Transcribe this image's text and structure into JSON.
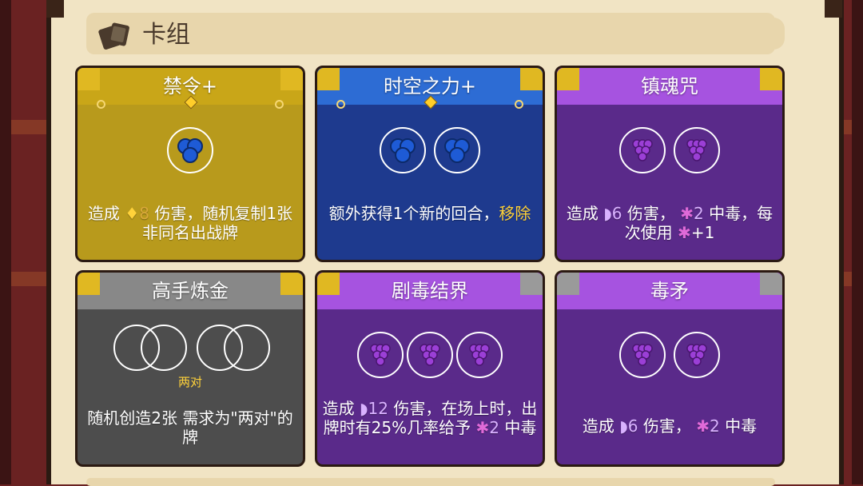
{
  "colors": {
    "gold_card": "#b89a1c",
    "gold_top": "#c9a618",
    "blue_card": "#1e3a8e",
    "blue_top": "#2d6cd4",
    "purple_card": "#5a2a8a",
    "purple_top": "#a653e0",
    "gray_card": "#4d4d4d",
    "gray_top": "#888888",
    "panel_bg": "#f1e4c4"
  },
  "header": {
    "title": "卡组",
    "icon": "cards-icon"
  },
  "cards": [
    {
      "name": "禁令+",
      "rarity_color": "gold",
      "requirements": [
        "blue-orb-icon"
      ],
      "description": {
        "pre": "造成 ",
        "sym": "♦",
        "num": "8",
        "post": " 伤害，随机复制1张非同名出战牌"
      }
    },
    {
      "name": "时空之力+",
      "rarity_color": "blue",
      "requirements": [
        "blue-orb-icon",
        "blue-orb-icon"
      ],
      "description": {
        "pre": "额外获得1个新的回合，",
        "highlight": "移除"
      }
    },
    {
      "name": "镇魂咒",
      "rarity_color": "purple",
      "requirements": [
        "purple-grape-icon",
        "purple-grape-icon"
      ],
      "description": {
        "pre": "造成 ",
        "sym": "◗",
        "num": "6",
        "mid": " 伤害， ",
        "sym2": "✱",
        "num2": "2",
        "post": " 中毒，每次使用 ",
        "sym3": "✱",
        "num3": "+1"
      }
    },
    {
      "name": "高手炼金",
      "rarity_color": "gray",
      "requirements": [
        "empty-pair-icon",
        "empty-pair-icon"
      ],
      "pair_label": "两对",
      "description": {
        "pre": "随机创造2张 需求为\"两对\"的牌"
      }
    },
    {
      "name": "剧毒结界",
      "rarity_color": "purple",
      "requirements": [
        "purple-grape-icon",
        "purple-grape-icon",
        "purple-grape-icon"
      ],
      "description": {
        "pre": "造成 ",
        "sym": "◗",
        "num": "12",
        "mid": " 伤害，在场上时，出牌时有25%几率给予 ",
        "sym2": "✱",
        "num2": "2",
        "post": " 中毒"
      }
    },
    {
      "name": "毒矛",
      "rarity_color": "purple",
      "requirements": [
        "purple-grape-icon",
        "purple-grape-icon"
      ],
      "description": {
        "pre": "造成 ",
        "sym": "◗",
        "num": "6",
        "mid": " 伤害， ",
        "sym2": "✱",
        "num2": "2",
        "post": " 中毒"
      }
    }
  ]
}
